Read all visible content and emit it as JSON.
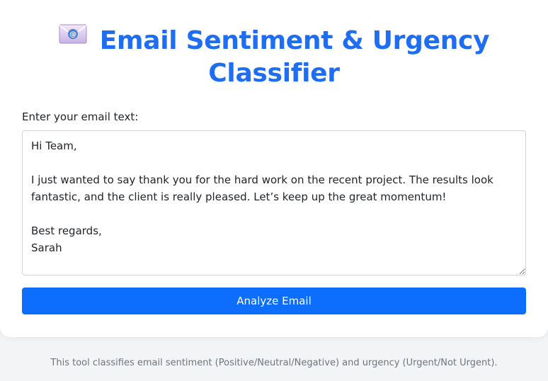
{
  "header": {
    "icon": "email-envelope-icon",
    "title": "Email Sentiment & Urgency Classifier"
  },
  "form": {
    "label": "Enter your email text:",
    "email_text": "Hi Team,\n\nI just wanted to say thank you for the hard work on the recent project. The results look fantastic, and the client is really pleased. Let’s keep up the great momentum!\n\nBest regards,\nSarah",
    "analyze_label": "Analyze Email"
  },
  "footer": {
    "text": "This tool classifies email sentiment (Positive/Neutral/Negative) and urgency (Urgent/Not Urgent)."
  },
  "colors": {
    "title": "#1d6ef2",
    "button": "#0d6efd",
    "background": "#f3f4f6"
  }
}
